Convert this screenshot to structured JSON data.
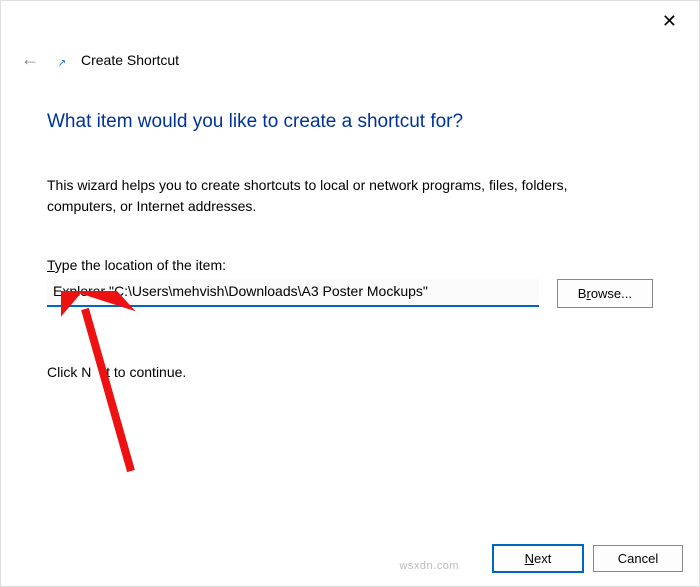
{
  "window": {
    "close_glyph": "✕",
    "back_glyph": "←",
    "shortcut_glyph": "↗",
    "title": "Create Shortcut"
  },
  "main": {
    "heading": "What item would you like to create a shortcut for?",
    "wizard_text": "This wizard helps you to create shortcuts to local or network programs, files, folders, computers, or Internet addresses.",
    "field_label_pre": "T",
    "field_label_rest": "ype the location of the item:",
    "location_value": "Explorer \"C:\\Users\\mehvish\\Downloads\\A3 Poster Mockups\"",
    "browse_label_pre": "B",
    "browse_label_und": "r",
    "browse_label_post": "owse...",
    "continue_pre": "Click N",
    "continue_post": "t to continue."
  },
  "footer": {
    "next_und": "N",
    "next_rest": "ext",
    "cancel": "Cancel"
  },
  "watermark": "wsxdn.com"
}
